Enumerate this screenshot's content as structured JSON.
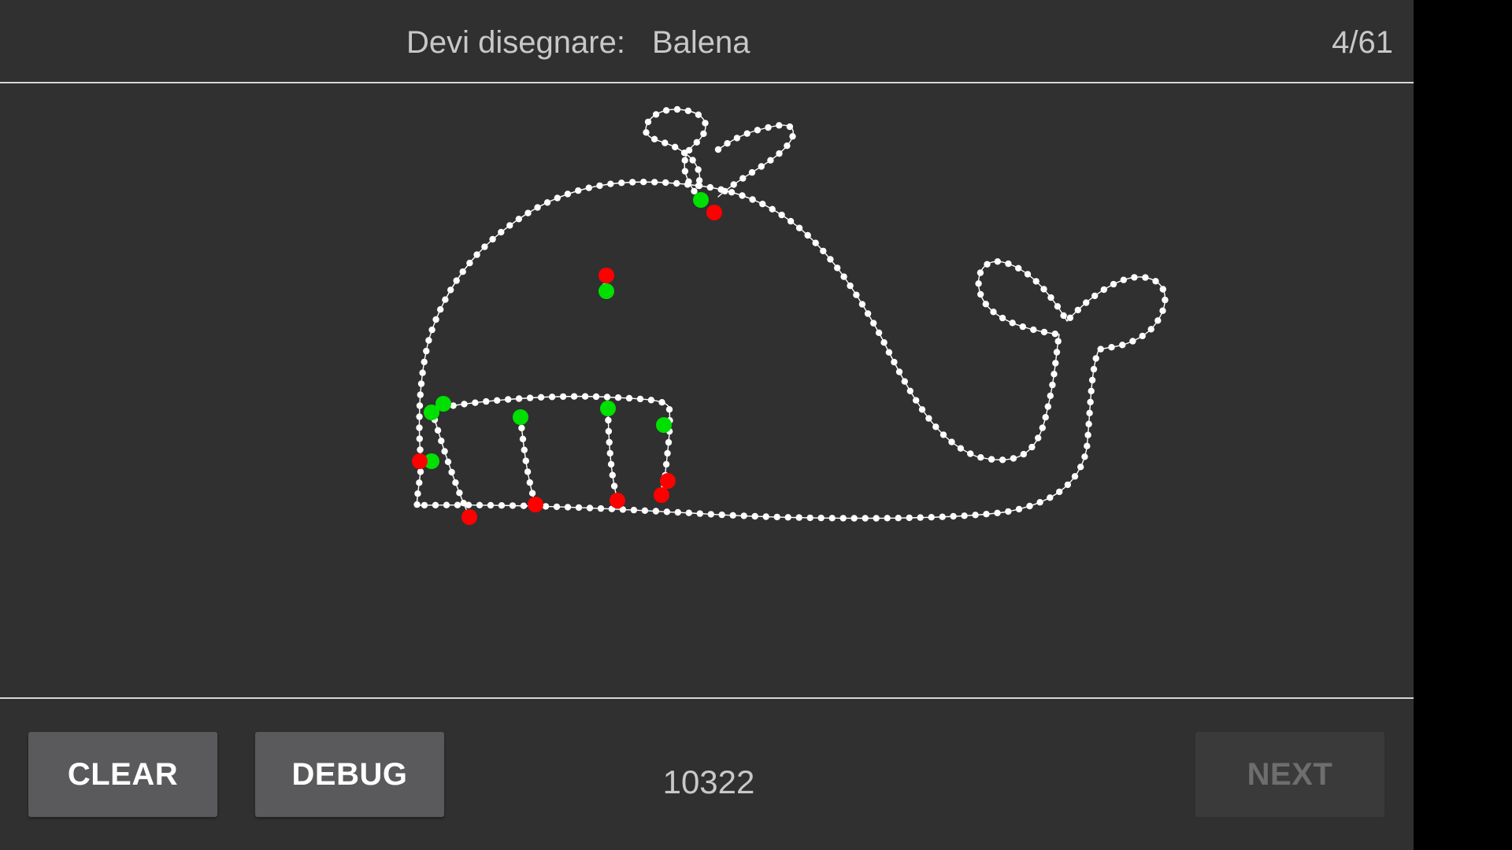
{
  "header": {
    "prompt_label": "Devi disegnare:",
    "target_word": "Balena",
    "progress": "4/61"
  },
  "canvas": {
    "subject": "whale drawing",
    "stroke_color": "#ffffff",
    "start_point_color": "#00e000",
    "end_point_color": "#ff0000"
  },
  "footer": {
    "clear_label": "CLEAR",
    "debug_label": "DEBUG",
    "score": "10322",
    "next_label": "NEXT"
  },
  "colors": {
    "background": "#303030",
    "button": "#5a5a5c",
    "button_disabled": "#3a3a3a",
    "text": "#c8c8c8"
  }
}
